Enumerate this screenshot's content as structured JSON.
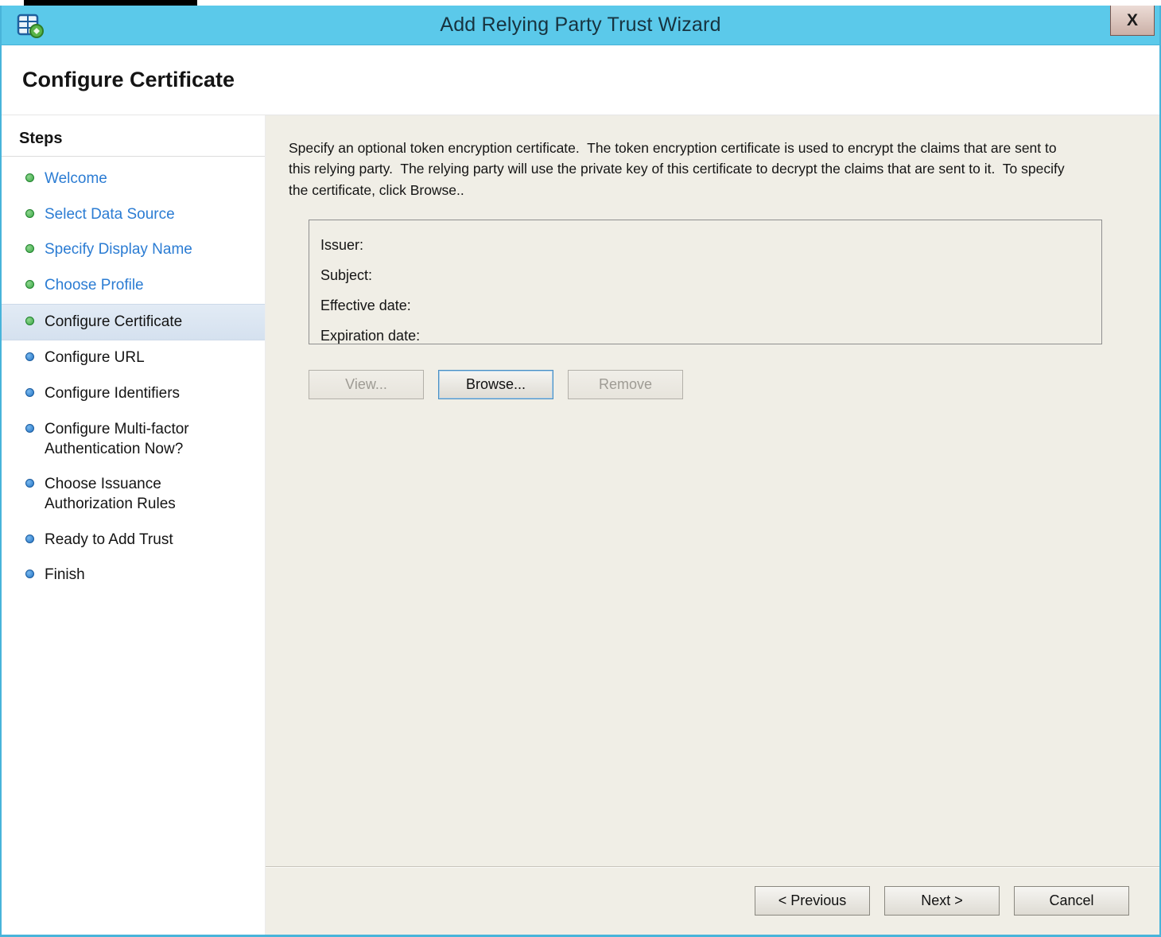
{
  "window": {
    "title": "Add Relying Party Trust Wizard",
    "close_label": "X"
  },
  "header": {
    "title": "Configure Certificate"
  },
  "sidebar": {
    "heading": "Steps",
    "steps": [
      {
        "label": "Welcome",
        "state": "completed"
      },
      {
        "label": "Select Data Source",
        "state": "completed"
      },
      {
        "label": "Specify Display Name",
        "state": "completed"
      },
      {
        "label": "Choose Profile",
        "state": "completed"
      },
      {
        "label": "Configure Certificate",
        "state": "current"
      },
      {
        "label": "Configure URL",
        "state": "upcoming"
      },
      {
        "label": "Configure Identifiers",
        "state": "upcoming"
      },
      {
        "label": "Configure Multi-factor Authentication Now?",
        "state": "upcoming"
      },
      {
        "label": "Choose Issuance Authorization Rules",
        "state": "upcoming"
      },
      {
        "label": "Ready to Add Trust",
        "state": "upcoming"
      },
      {
        "label": "Finish",
        "state": "upcoming"
      }
    ]
  },
  "content": {
    "description": "Specify an optional token encryption certificate.  The token encryption certificate is used to encrypt the claims that are sent to this relying party.  The relying party will use the private key of this certificate to decrypt the claims that are sent to it.  To specify the certificate, click Browse..",
    "certificate_fields": [
      {
        "label": "Issuer:",
        "value": ""
      },
      {
        "label": "Subject:",
        "value": ""
      },
      {
        "label": "Effective date:",
        "value": ""
      },
      {
        "label": "Expiration date:",
        "value": ""
      }
    ],
    "buttons": {
      "view": "View...",
      "browse": "Browse...",
      "remove": "Remove"
    }
  },
  "footer": {
    "previous": "< Previous",
    "next": "Next >",
    "cancel": "Cancel"
  },
  "colors": {
    "titlebar": "#5bc9ea",
    "window_border": "#48b4da",
    "link_blue": "#2b7cd3",
    "step_done_green": "#3aa845",
    "step_next_blue": "#2272c3",
    "content_bg": "#f0eee6",
    "highlight_bg": "#e2ebf5",
    "button_focus_border": "#4a90c4"
  }
}
